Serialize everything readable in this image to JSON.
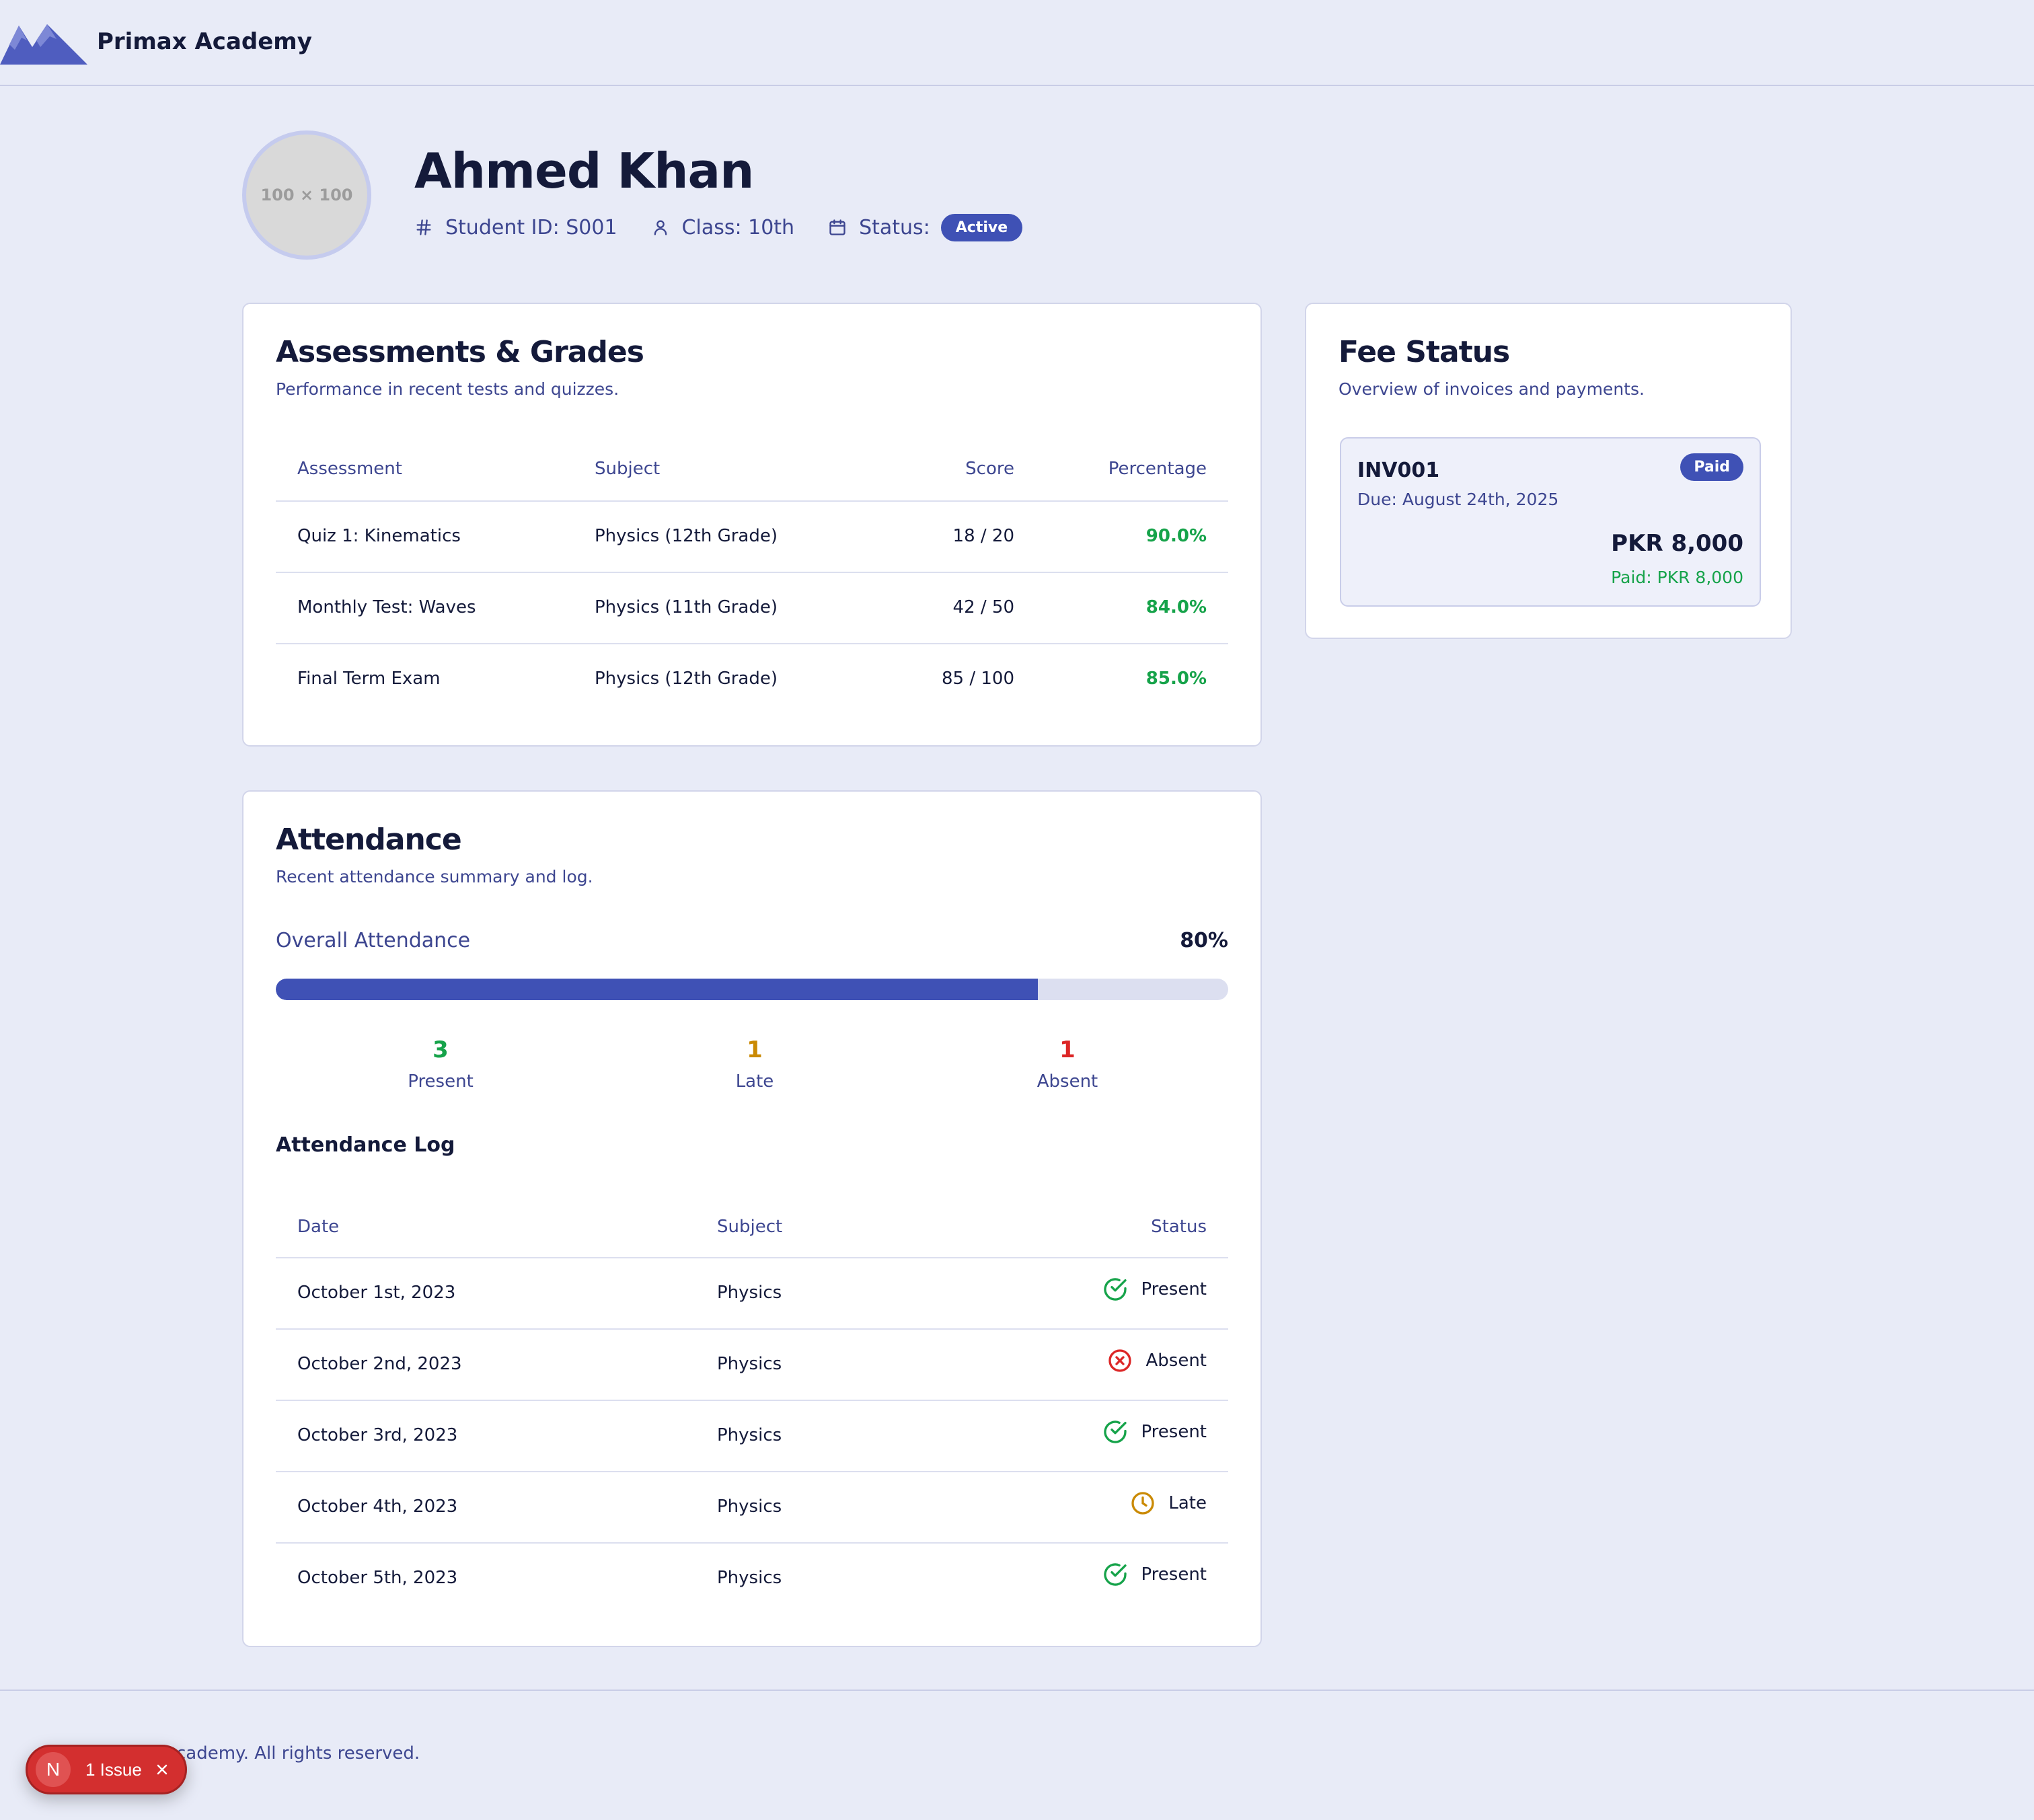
{
  "app": {
    "brand": "Primax Academy"
  },
  "student": {
    "avatar_placeholder": "100 × 100",
    "name": "Ahmed Khan",
    "id_label": "Student ID: S001",
    "class_label": "Class: 10th",
    "status_label": "Status:",
    "status_value": "Active"
  },
  "assessments": {
    "title": "Assessments & Grades",
    "subtitle": "Performance in recent tests and quizzes.",
    "columns": [
      "Assessment",
      "Subject",
      "Score",
      "Percentage"
    ],
    "rows": [
      {
        "assessment": "Quiz 1: Kinematics",
        "subject": "Physics (12th Grade)",
        "score": "18 / 20",
        "percentage": "90.0%"
      },
      {
        "assessment": "Monthly Test: Waves",
        "subject": "Physics (11th Grade)",
        "score": "42 / 50",
        "percentage": "84.0%"
      },
      {
        "assessment": "Final Term Exam",
        "subject": "Physics (12th Grade)",
        "score": "85 / 100",
        "percentage": "85.0%"
      }
    ]
  },
  "fees": {
    "title": "Fee Status",
    "subtitle": "Overview of invoices and payments.",
    "invoice": {
      "id": "INV001",
      "status": "Paid",
      "due": "Due: August 24th, 2025",
      "amount": "PKR 8,000",
      "paid": "Paid: PKR 8,000"
    }
  },
  "attendance": {
    "title": "Attendance",
    "subtitle": "Recent attendance summary and log.",
    "overall_label": "Overall Attendance",
    "overall_value": "80%",
    "overall_fraction": 0.8,
    "stats": [
      {
        "count": "3",
        "label": "Present",
        "color": "#16a34a"
      },
      {
        "count": "1",
        "label": "Late",
        "color": "#ca8a04"
      },
      {
        "count": "1",
        "label": "Absent",
        "color": "#dc2626"
      }
    ],
    "log_title": "Attendance Log",
    "columns": [
      "Date",
      "Subject",
      "Status"
    ],
    "rows": [
      {
        "date": "October 1st, 2023",
        "subject": "Physics",
        "status": "Present",
        "icon": "check-circle-icon"
      },
      {
        "date": "October 2nd, 2023",
        "subject": "Physics",
        "status": "Absent",
        "icon": "x-circle-icon"
      },
      {
        "date": "October 3rd, 2023",
        "subject": "Physics",
        "status": "Present",
        "icon": "check-circle-icon"
      },
      {
        "date": "October 4th, 2023",
        "subject": "Physics",
        "status": "Late",
        "icon": "clock-icon"
      },
      {
        "date": "October 5th, 2023",
        "subject": "Physics",
        "status": "Present",
        "icon": "check-circle-icon"
      }
    ]
  },
  "footer": {
    "text": "cademy. All rights reserved."
  },
  "dev_overlay": {
    "badge_letter": "N",
    "issues_label": "1 Issue"
  },
  "colors": {
    "accent": "#3f51b5",
    "success": "#16a34a",
    "warning": "#ca8a04",
    "danger": "#dc2626"
  }
}
